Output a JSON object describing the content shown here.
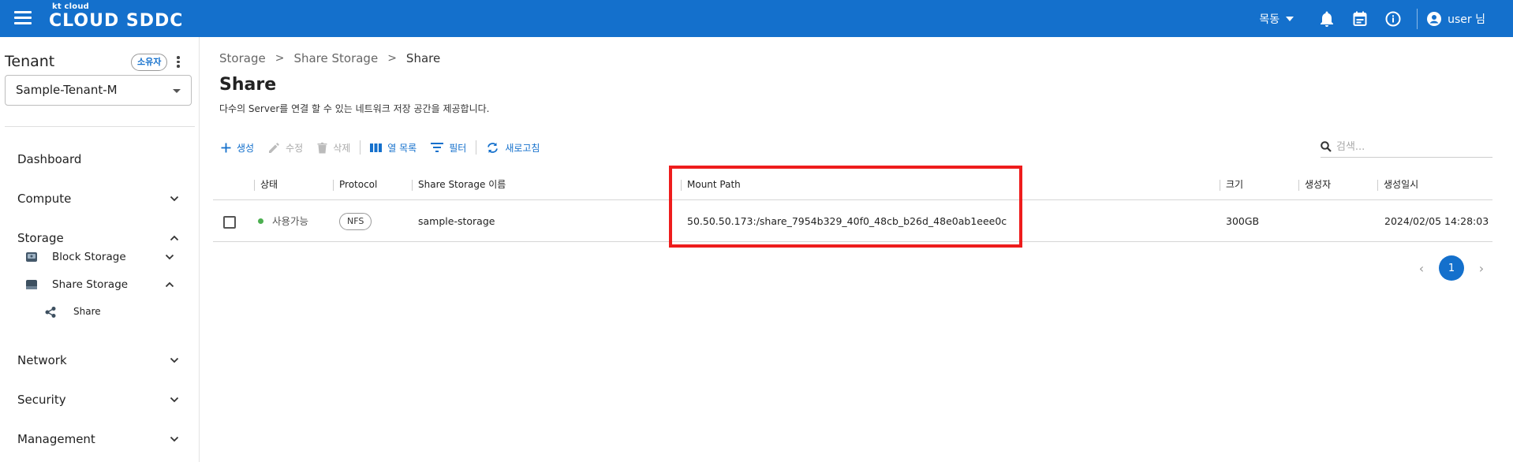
{
  "topbar": {
    "logo_small": "kt cloud",
    "logo_big": "CLOUD SDDC",
    "location": "목동",
    "user_label": "user 님"
  },
  "sidebar": {
    "tenant_title": "Tenant",
    "owner_badge": "소유자",
    "tenant_selected": "Sample-Tenant-M",
    "items": [
      {
        "label": "Dashboard"
      },
      {
        "label": "Compute"
      },
      {
        "label": "Storage"
      },
      {
        "label": "Block Storage"
      },
      {
        "label": "Share Storage"
      },
      {
        "label": "Share"
      },
      {
        "label": "Network"
      },
      {
        "label": "Security"
      },
      {
        "label": "Management"
      }
    ]
  },
  "breadcrumb": [
    "Storage",
    "Share Storage",
    "Share"
  ],
  "page": {
    "title": "Share",
    "description": "다수의 Server를 연결 할 수 있는 네트워크 저장 공간을 제공합니다."
  },
  "toolbar": {
    "create": "생성",
    "edit": "수정",
    "delete": "삭제",
    "columns": "열 목록",
    "filter": "필터",
    "refresh": "새로고침"
  },
  "search": {
    "placeholder": "검색..."
  },
  "table": {
    "headers": [
      "상태",
      "Protocol",
      "Share Storage 이름",
      "Mount Path",
      "크기",
      "생성자",
      "생성일시"
    ],
    "rows": [
      {
        "status": "사용가능",
        "protocol": "NFS",
        "name": "sample-storage",
        "mount_path": "50.50.50.173:/share_7954b329_40f0_48cb_b26d_48e0ab1eee0c",
        "size": "300GB",
        "creator": "",
        "created_at": "2024/02/05 14:28:03"
      }
    ]
  },
  "pagination": {
    "current": "1",
    "prev": "‹",
    "next": "›"
  },
  "colors": {
    "brand": "#1470cc",
    "highlight": "#ee1c1c",
    "status_ok": "#4caf50"
  }
}
